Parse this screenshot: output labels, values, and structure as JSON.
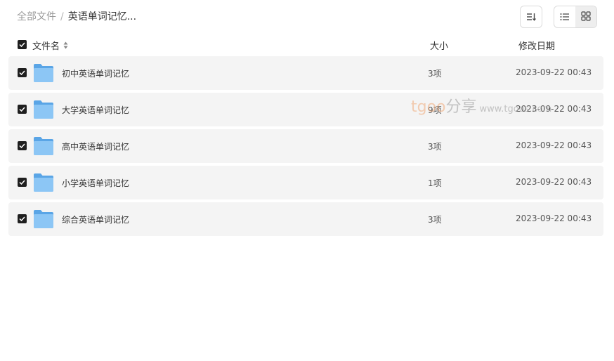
{
  "breadcrumb": {
    "root": "全部文件",
    "separator": "/",
    "current": "英语单词记忆..."
  },
  "toolbar": {
    "sort_icon": "sort-icon",
    "list_view_icon": "list-view-icon",
    "grid_view_icon": "grid-view-icon",
    "active_view": "list"
  },
  "columns": {
    "name": "文件名",
    "size": "大小",
    "modified": "修改日期"
  },
  "files": [
    {
      "name": "初中英语单词记忆",
      "size": "3项",
      "modified": "2023-09-22 00:43",
      "checked": true
    },
    {
      "name": "大学英语单词记忆",
      "size": "9项",
      "modified": "2023-09-22 00:43",
      "checked": true
    },
    {
      "name": "高中英语单词记忆",
      "size": "3项",
      "modified": "2023-09-22 00:43",
      "checked": true
    },
    {
      "name": "小学英语单词记忆",
      "size": "1项",
      "modified": "2023-09-22 00:43",
      "checked": true
    },
    {
      "name": "综合英语单词记忆",
      "size": "3项",
      "modified": "2023-09-22 00:43",
      "checked": true
    }
  ],
  "watermark": {
    "brand": "tgoo",
    "share": "分享",
    "url": "www.tgoos.com"
  },
  "colors": {
    "row_bg": "#f4f4f4",
    "checkbox": "#1f1f1f",
    "folder": "#6fb3ec"
  }
}
